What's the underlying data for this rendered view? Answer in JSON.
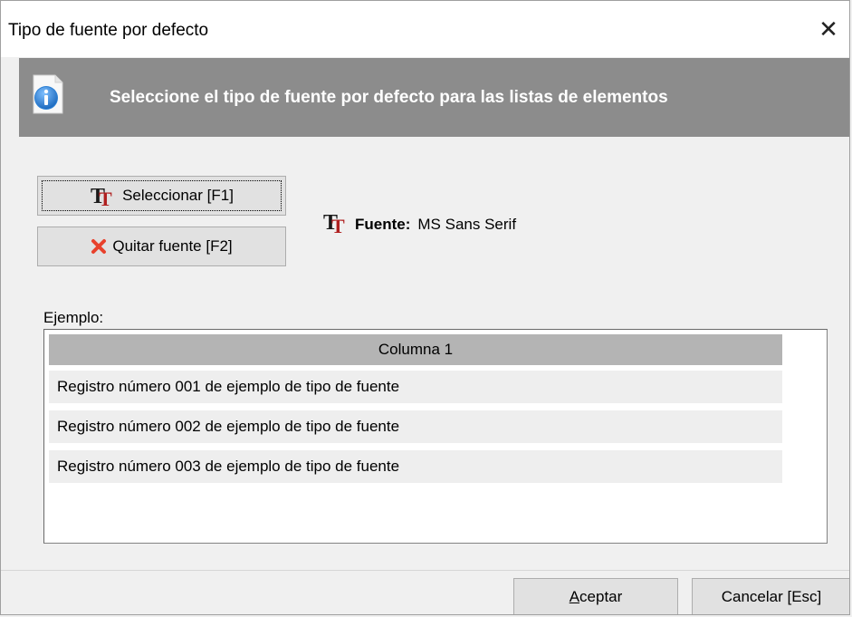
{
  "window": {
    "title": "Tipo de fuente por defecto",
    "close_glyph": "✕"
  },
  "banner": {
    "icon": "info-icon",
    "text": "Seleccione el tipo de fuente por defecto para las listas de elementos"
  },
  "buttons": {
    "select_label": "Seleccionar  [F1]",
    "select_icon": "font-icon",
    "remove_label": "Quitar fuente [F2]",
    "remove_icon": "red-x-icon"
  },
  "font": {
    "label": "Fuente:",
    "value": "MS Sans Serif",
    "icon": "font-icon"
  },
  "example": {
    "label": "Ejemplo:",
    "column_header": "Columna 1",
    "rows": [
      "Registro número 001 de ejemplo de tipo de fuente",
      "Registro número 002 de ejemplo de tipo de fuente",
      "Registro número 003 de ejemplo de tipo de fuente"
    ]
  },
  "footer": {
    "ok_accel": "A",
    "ok_rest": "ceptar",
    "cancel_label": "Cancelar  [Esc]"
  },
  "colors": {
    "banner_bg": "#8c8c8c",
    "header_bg": "#b4b4b4",
    "row_bg": "#eeeeee",
    "remove_icon": "#e8412c"
  }
}
